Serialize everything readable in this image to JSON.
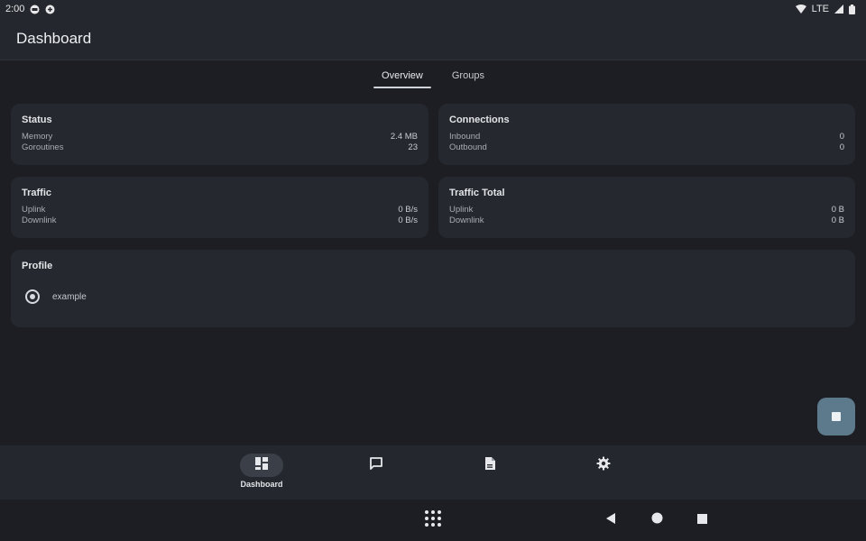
{
  "status_bar": {
    "time": "2:00",
    "network": "LTE"
  },
  "app_bar": {
    "title": "Dashboard"
  },
  "tabs": [
    {
      "label": "Overview",
      "active": true
    },
    {
      "label": "Groups",
      "active": false
    }
  ],
  "cards": {
    "status": {
      "title": "Status",
      "rows": [
        {
          "label": "Memory",
          "value": "2.4 MB"
        },
        {
          "label": "Goroutines",
          "value": "23"
        }
      ]
    },
    "connections": {
      "title": "Connections",
      "rows": [
        {
          "label": "Inbound",
          "value": "0"
        },
        {
          "label": "Outbound",
          "value": "0"
        }
      ]
    },
    "traffic": {
      "title": "Traffic",
      "rows": [
        {
          "label": "Uplink",
          "value": "0 B/s"
        },
        {
          "label": "Downlink",
          "value": "0 B/s"
        }
      ]
    },
    "traffic_total": {
      "title": "Traffic Total",
      "rows": [
        {
          "label": "Uplink",
          "value": "0 B"
        },
        {
          "label": "Downlink",
          "value": "0 B"
        }
      ]
    },
    "profile": {
      "title": "Profile",
      "items": [
        {
          "name": "example",
          "selected": true
        }
      ]
    }
  },
  "bottom_nav": {
    "items": [
      {
        "label": "Dashboard",
        "icon": "dashboard-icon",
        "active": true
      },
      {
        "label": "",
        "icon": "chat-icon",
        "active": false
      },
      {
        "label": "",
        "icon": "file-icon",
        "active": false
      },
      {
        "label": "",
        "icon": "gear-icon",
        "active": false
      }
    ]
  },
  "colors": {
    "background": "#1c1e23",
    "surface": "#25282e",
    "fab": "#5d7a8c",
    "nav_indicator": "#3a3f48"
  }
}
